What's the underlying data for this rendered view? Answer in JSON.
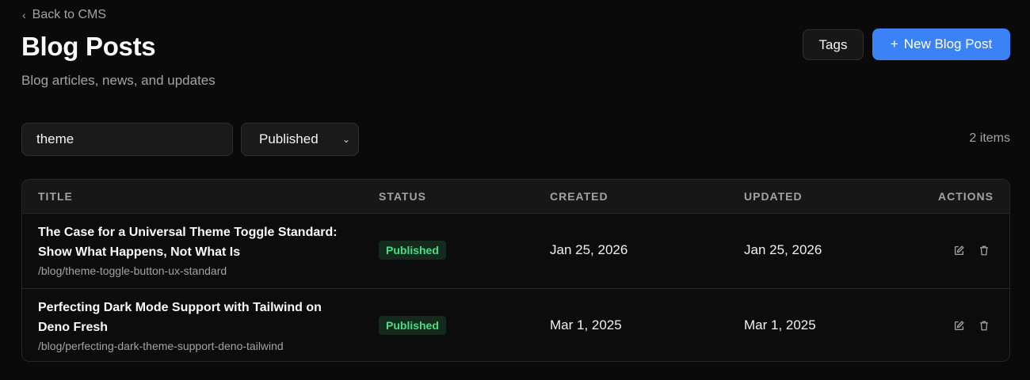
{
  "nav": {
    "back_label": "Back to CMS"
  },
  "header": {
    "title": "Blog Posts",
    "subtitle": "Blog articles, news, and updates",
    "tags_label": "Tags",
    "new_post_label": "New Blog Post"
  },
  "filters": {
    "search_value": "theme",
    "status_selected": "Published",
    "item_count": "2 items"
  },
  "table": {
    "columns": {
      "title": "TITLE",
      "status": "STATUS",
      "created": "CREATED",
      "updated": "UPDATED",
      "actions": "ACTIONS"
    },
    "rows": [
      {
        "title": "The Case for a Universal Theme Toggle Standard: Show What Happens, Not What Is",
        "slug": "/blog/theme-toggle-button-ux-standard",
        "status": "Published",
        "created": "Jan 25, 2026",
        "updated": "Jan 25, 2026"
      },
      {
        "title": "Perfecting Dark Mode Support with Tailwind on Deno Fresh",
        "slug": "/blog/perfecting-dark-theme-support-deno-tailwind",
        "status": "Published",
        "created": "Mar 1, 2025",
        "updated": "Mar 1, 2025"
      }
    ]
  },
  "icons": {
    "back": "chevron-left-icon",
    "add": "plus-icon",
    "select": "chevron-down-icon",
    "edit": "edit-icon",
    "delete": "trash-icon"
  },
  "colors": {
    "accent": "#3b82f6",
    "published_text": "#4ade80",
    "published_bg": "#132a1c",
    "background": "#0a0a0a"
  }
}
